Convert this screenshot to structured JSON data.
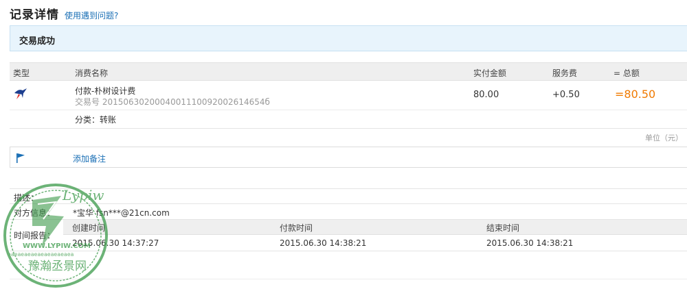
{
  "header": {
    "title": "记录详情",
    "help_link": "使用遇到问题?"
  },
  "status": {
    "text": "交易成功"
  },
  "transaction_table": {
    "columns": {
      "type": "类型",
      "name": "消费名称",
      "amount": "实付金额",
      "fee": "服务费",
      "total": "= 总额"
    },
    "row": {
      "icon": "transfer-swallow-icon",
      "name": "付款-朴树设计费",
      "trade_no": "交易号 2015063020004001110092002614654б",
      "amount": "80.00",
      "fee": "+0.50",
      "total": "=80.50",
      "category": "分类：转账"
    }
  },
  "unit_note": "单位（元）",
  "memo": {
    "icon": "flag-icon",
    "link": "添加备注"
  },
  "info": {
    "desc_label": "描述：",
    "party_label": "对方信息：",
    "party_value": "*宝华 fsn***@21cn.com",
    "time_label": "时间报告：",
    "time_headers": [
      "创建时间",
      "付款时间",
      "结束时间"
    ],
    "time_values": [
      "2015.06.30 14:37:27",
      "2015.06.30 14:38:21",
      "2015.06.30 14:38:21"
    ]
  },
  "watermark": {
    "top_text": "eaeaeaeaeaeaeaeaeaea",
    "url": "WWW.LYPIW.COM",
    "bottom_text": "豫瀚丞景网",
    "cursive": "Lypiw"
  },
  "colors": {
    "accent_link": "#1a6fb5",
    "total_orange": "#f07a00",
    "status_bg": "#e8f4fc",
    "watermark_green": "#3c9a4a"
  }
}
